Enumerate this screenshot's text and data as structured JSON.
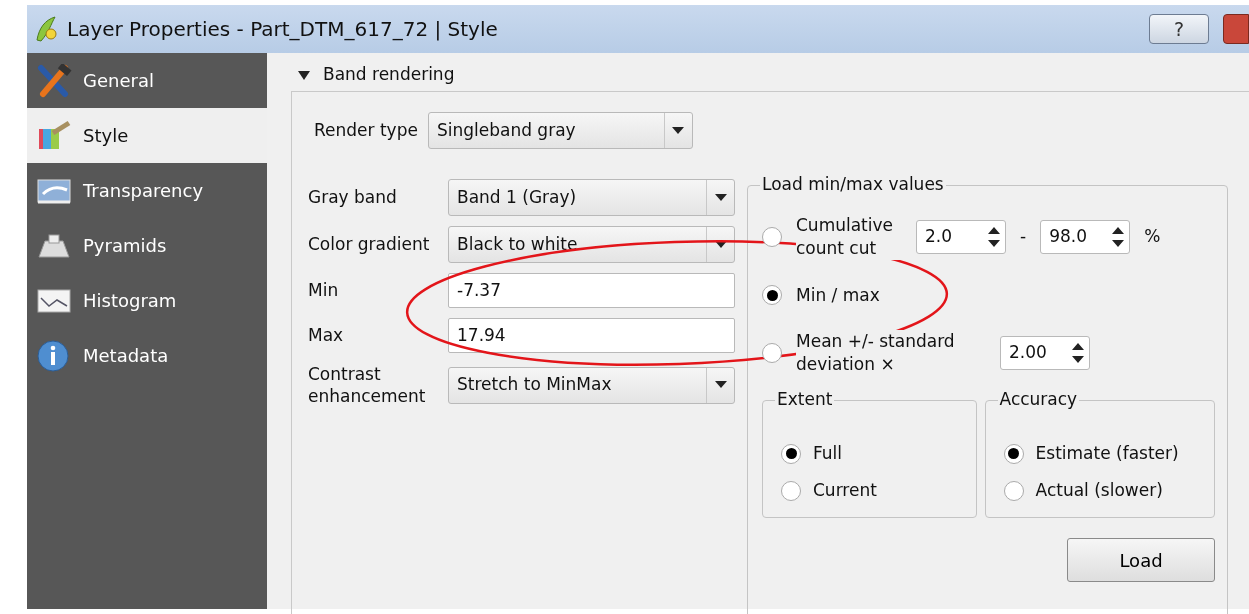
{
  "window": {
    "title": "Layer Properties - Part_DTM_617_72 | Style",
    "help_button": "?"
  },
  "sidebar": {
    "items": [
      {
        "label": "General",
        "selected": false
      },
      {
        "label": "Style",
        "selected": true
      },
      {
        "label": "Transparency",
        "selected": false
      },
      {
        "label": "Pyramids",
        "selected": false
      },
      {
        "label": "Histogram",
        "selected": false
      },
      {
        "label": "Metadata",
        "selected": false
      }
    ]
  },
  "band_rendering": {
    "title": "Band rendering",
    "expanded": true,
    "render_type": {
      "label": "Render type",
      "value": "Singleband gray"
    },
    "fields": [
      {
        "kind": "combo",
        "label": "Gray band",
        "value": "Band 1 (Gray)"
      },
      {
        "kind": "combo",
        "label": "Color gradient",
        "value": "Black to white"
      },
      {
        "kind": "text",
        "label": "Min",
        "value": "-7.37"
      },
      {
        "kind": "text",
        "label": "Max",
        "value": "17.94"
      },
      {
        "kind": "combo",
        "label": "Contrast enhancement",
        "value": "Stretch to MinMax"
      }
    ],
    "load_minmax": {
      "title": "Load min/max values",
      "options": [
        {
          "label": "Cumulative count cut",
          "selected": false,
          "spins": [
            "2.0",
            "98.0"
          ],
          "separator": "-",
          "unit": "%"
        },
        {
          "label": "Min / max",
          "selected": true
        },
        {
          "label": "Mean +/- standard deviation ×",
          "selected": false,
          "spins": [
            "2.00"
          ]
        }
      ],
      "extent": {
        "title": "Extent",
        "options": [
          {
            "label": "Full",
            "selected": true
          },
          {
            "label": "Current",
            "selected": false
          }
        ]
      },
      "accuracy": {
        "title": "Accuracy",
        "options": [
          {
            "label": "Estimate (faster)",
            "selected": true
          },
          {
            "label": "Actual (slower)",
            "selected": false
          }
        ]
      },
      "load_button": "Load"
    }
  }
}
